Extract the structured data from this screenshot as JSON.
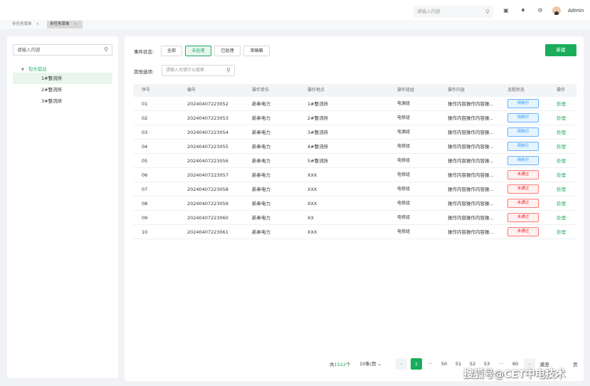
{
  "header": {
    "search_placeholder": "请输入内容",
    "user_name": "Admin",
    "icons": [
      "search-icon",
      "video-icon",
      "bell-icon",
      "gear-icon",
      "avatar"
    ]
  },
  "tabs": [
    {
      "label": "多任务菜单",
      "active": false
    },
    {
      "label": "多任务菜单",
      "active": true
    }
  ],
  "tree": {
    "search_placeholder": "请输入内容",
    "root_label": "包头铝业",
    "items": [
      "1#整流所",
      "2#整流所",
      "3#整流所"
    ],
    "selected_index": 0
  },
  "filters": {
    "status_label": "事件状态:",
    "status_options": [
      "全部",
      "未处理",
      "已处理",
      "草稿箱"
    ],
    "status_active_index": 1,
    "other_label": "其他选项:",
    "other_placeholder": "请输入关键字以搜索",
    "new_button": "新建"
  },
  "table": {
    "columns": [
      "序号",
      "编号",
      "操作单位",
      "操作地点",
      "操作班组",
      "操作内容",
      "流程状态",
      "操作"
    ],
    "rows": [
      {
        "no": "01",
        "code": "20240407223052",
        "unit": "新奉电力",
        "place": "1#整流所",
        "team": "电源组",
        "content": "操作内容操作内容操...",
        "status": "待执行",
        "status_type": "pending",
        "action": "处理"
      },
      {
        "no": "02",
        "code": "20240407223053",
        "unit": "新奉电力",
        "place": "2#整流所",
        "team": "电修组",
        "content": "操作内容操作内容操...",
        "status": "待执行",
        "status_type": "pending",
        "action": "处理"
      },
      {
        "no": "03",
        "code": "20240407223054",
        "unit": "新奉电力",
        "place": "3#整流所",
        "team": "电源组",
        "content": "操作内容操作内容操...",
        "status": "待执行",
        "status_type": "pending",
        "action": "处理"
      },
      {
        "no": "04",
        "code": "20240407223055",
        "unit": "新奉电力",
        "place": "4#整流所",
        "team": "电修组",
        "content": "操作内容操作内容操...",
        "status": "待执行",
        "status_type": "pending",
        "action": "处理"
      },
      {
        "no": "05",
        "code": "20240407223056",
        "unit": "新奉电力",
        "place": "5#整流所",
        "team": "电修组",
        "content": "操作内容操作内容操...",
        "status": "待执行",
        "status_type": "pending",
        "action": "处理"
      },
      {
        "no": "06",
        "code": "20240407223057",
        "unit": "新奉电力",
        "place": "XXX",
        "team": "电修组",
        "content": "操作内容操作内容操...",
        "status": "未通过",
        "status_type": "rejected",
        "action": "处理"
      },
      {
        "no": "07",
        "code": "20240407223058",
        "unit": "新奉电力",
        "place": "XXX",
        "team": "电修组",
        "content": "操作内容操作内容操...",
        "status": "未通过",
        "status_type": "rejected",
        "action": "处理"
      },
      {
        "no": "08",
        "code": "20240407223059",
        "unit": "新奉电力",
        "place": "XXX",
        "team": "电修组",
        "content": "操作内容操作内容操...",
        "status": "未通过",
        "status_type": "rejected",
        "action": "处理"
      },
      {
        "no": "09",
        "code": "20240407223060",
        "unit": "新奉电力",
        "place": "XX",
        "team": "电修组",
        "content": "操作内容操作内容操...",
        "status": "未通过",
        "status_type": "rejected",
        "action": "处理"
      },
      {
        "no": "10",
        "code": "20240407223061",
        "unit": "新奉电力",
        "place": "XXX",
        "team": "电修组",
        "content": "操作内容操作内容操...",
        "status": "未通过",
        "status_type": "rejected",
        "action": "处理"
      }
    ]
  },
  "pagination": {
    "total_prefix": "共",
    "total_count": "1522",
    "total_suffix": "个",
    "page_size": "10条/页",
    "pages": [
      "1",
      "···",
      "50",
      "51",
      "52",
      "53",
      "···",
      "90"
    ],
    "current_page": "1",
    "jump_label": "跳至",
    "jump_suffix": "页"
  },
  "watermark": "搜狐号@CET中电技术",
  "colors": {
    "accent": "#1aad5b",
    "pending": "#1890ff",
    "rejected": "#f5222d"
  }
}
